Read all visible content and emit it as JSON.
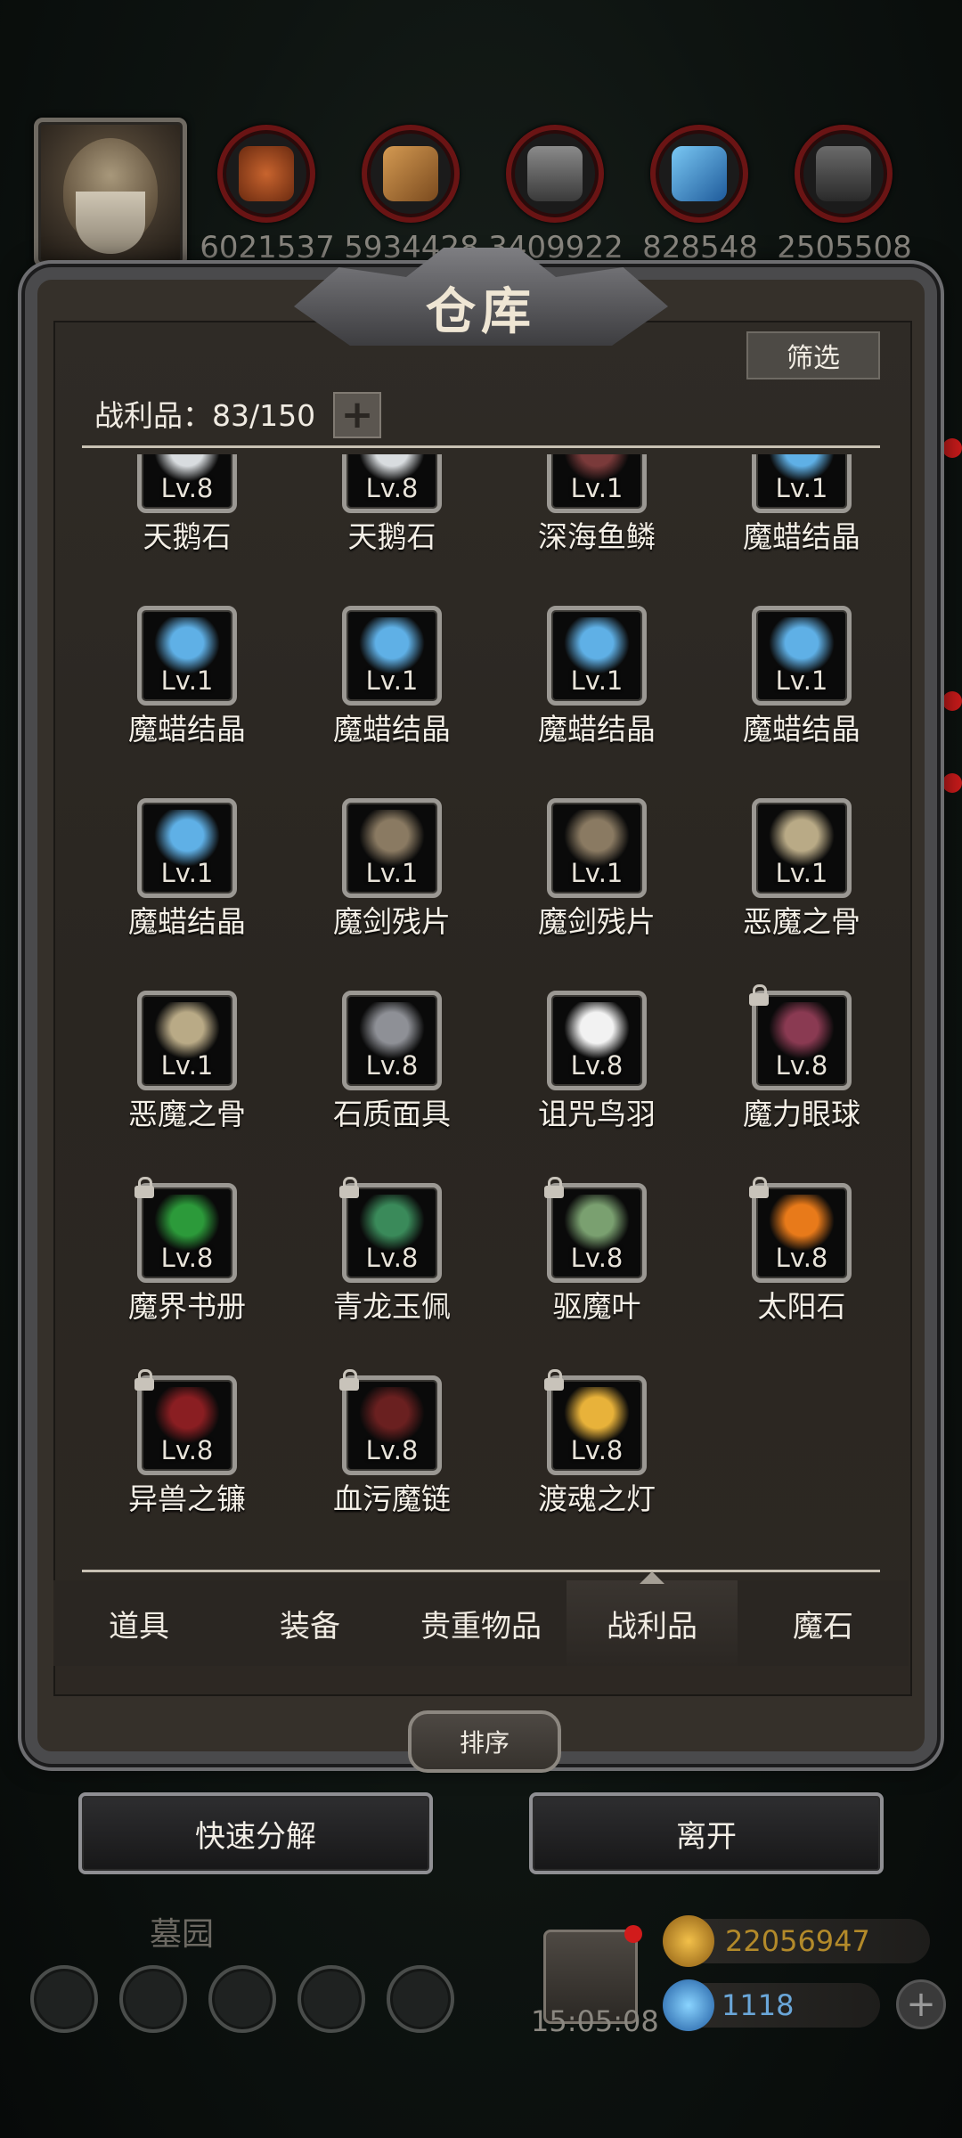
{
  "resources": [
    {
      "value": "6021537",
      "icon": "meat-icon",
      "color": "#9a4a22"
    },
    {
      "value": "5934428",
      "icon": "wood-icon",
      "color": "#b07a3a"
    },
    {
      "value": "3409922",
      "icon": "stone-icon",
      "color": "#6b6b6b"
    },
    {
      "value": "828548",
      "icon": "crystal-icon",
      "color": "#3a8ad0"
    },
    {
      "value": "2505508",
      "icon": "iron-icon",
      "color": "#5a5a5a"
    }
  ],
  "window": {
    "title": "仓库",
    "filter_label": "筛选",
    "capacity_label": "战利品：83/150",
    "plus_label": "+"
  },
  "items": [
    {
      "name": "天鹅石",
      "level": "Lv.8",
      "icon": "swan-stone-icon",
      "color": "#d8dcdf",
      "locked": false
    },
    {
      "name": "天鹅石",
      "level": "Lv.8",
      "icon": "swan-stone-icon",
      "color": "#d8dcdf",
      "locked": false
    },
    {
      "name": "深海鱼鳞",
      "level": "Lv.1",
      "icon": "fish-scale-icon",
      "color": "#7a3a3a",
      "locked": false
    },
    {
      "name": "魔蜡结晶",
      "level": "Lv.1",
      "icon": "wax-crystal-icon",
      "color": "#5fb0e6",
      "locked": false
    },
    {
      "name": "魔蜡结晶",
      "level": "Lv.1",
      "icon": "wax-crystal-icon",
      "color": "#5fb0e6",
      "locked": false
    },
    {
      "name": "魔蜡结晶",
      "level": "Lv.1",
      "icon": "wax-crystal-icon",
      "color": "#5fb0e6",
      "locked": false
    },
    {
      "name": "魔蜡结晶",
      "level": "Lv.1",
      "icon": "wax-crystal-icon",
      "color": "#5fb0e6",
      "locked": false
    },
    {
      "name": "魔蜡结晶",
      "level": "Lv.1",
      "icon": "wax-crystal-icon",
      "color": "#5fb0e6",
      "locked": false
    },
    {
      "name": "魔蜡结晶",
      "level": "Lv.1",
      "icon": "wax-crystal-icon",
      "color": "#5fb0e6",
      "locked": false
    },
    {
      "name": "魔剑残片",
      "level": "Lv.1",
      "icon": "sword-shard-icon",
      "color": "#8a7a62",
      "locked": false
    },
    {
      "name": "魔剑残片",
      "level": "Lv.1",
      "icon": "sword-shard-icon",
      "color": "#8a7a62",
      "locked": false
    },
    {
      "name": "恶魔之骨",
      "level": "Lv.1",
      "icon": "demon-bone-icon",
      "color": "#b9aa86",
      "locked": false
    },
    {
      "name": "恶魔之骨",
      "level": "Lv.1",
      "icon": "demon-bone-icon",
      "color": "#b9aa86",
      "locked": false
    },
    {
      "name": "石质面具",
      "level": "Lv.8",
      "icon": "stone-mask-icon",
      "color": "#8e9096",
      "locked": false
    },
    {
      "name": "诅咒鸟羽",
      "level": "Lv.8",
      "icon": "feather-icon",
      "color": "#f2f2f2",
      "locked": false
    },
    {
      "name": "魔力眼球",
      "level": "Lv.8",
      "icon": "eyeball-icon",
      "color": "#8a3a52",
      "locked": true
    },
    {
      "name": "魔界书册",
      "level": "Lv.8",
      "icon": "demon-book-icon",
      "color": "#2c9a3a",
      "locked": true
    },
    {
      "name": "青龙玉佩",
      "level": "Lv.8",
      "icon": "jade-dragon-icon",
      "color": "#3a8a5a",
      "locked": true
    },
    {
      "name": "驱魔叶",
      "level": "Lv.8",
      "icon": "exorcism-leaf-icon",
      "color": "#7aa070",
      "locked": true
    },
    {
      "name": "太阳石",
      "level": "Lv.8",
      "icon": "sun-stone-icon",
      "color": "#e87a1a",
      "locked": true
    },
    {
      "name": "异兽之镰",
      "level": "Lv.8",
      "icon": "beast-scythe-icon",
      "color": "#8a1e22",
      "locked": true
    },
    {
      "name": "血污魔链",
      "level": "Lv.8",
      "icon": "bloody-chain-icon",
      "color": "#6a2020",
      "locked": true
    },
    {
      "name": "渡魂之灯",
      "level": "Lv.8",
      "icon": "soul-lantern-icon",
      "color": "#e8b23a",
      "locked": true
    }
  ],
  "tabs": [
    {
      "label": "道具",
      "active": false
    },
    {
      "label": "装备",
      "active": false
    },
    {
      "label": "贵重物品",
      "active": false
    },
    {
      "label": "战利品",
      "active": true
    },
    {
      "label": "魔石",
      "active": false
    }
  ],
  "sort_label": "排序",
  "actions": {
    "decompose": "快速分解",
    "leave": "离开"
  },
  "bottom": {
    "zone_label": "墓园",
    "timer": "15:05:08",
    "gold": "22056947",
    "gems": "1118"
  }
}
